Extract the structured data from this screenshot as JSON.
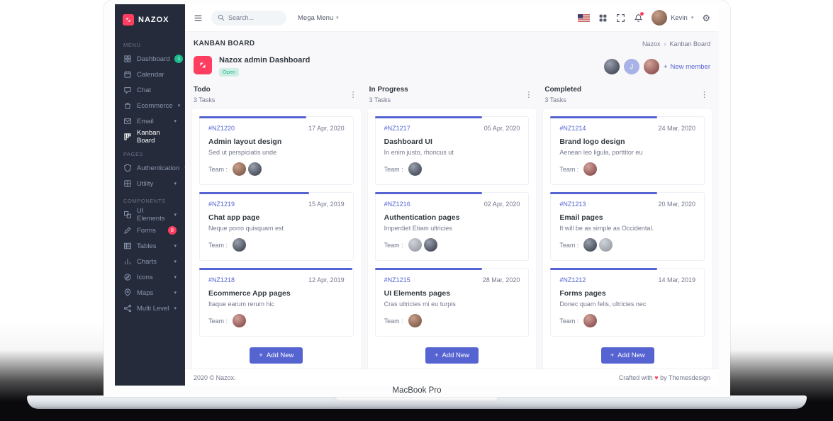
{
  "device": {
    "label": "MacBook Pro"
  },
  "colors": {
    "accent": "#5664d2",
    "sidebar_bg": "#252b3b",
    "success": "#1cbb8c",
    "danger": "#ff3d60"
  },
  "sidebar": {
    "logo_text": "NAZOX",
    "section_menu": "MENU",
    "section_pages": "PAGES",
    "section_components": "COMPONENTS",
    "items": [
      {
        "label": "Dashboard",
        "icon": "dashboard-icon",
        "badge": "1"
      },
      {
        "label": "Calendar",
        "icon": "calendar-icon"
      },
      {
        "label": "Chat",
        "icon": "chat-icon"
      },
      {
        "label": "Ecommerce",
        "icon": "shopping-bag-icon",
        "chevron": "true"
      },
      {
        "label": "Email",
        "icon": "envelope-icon",
        "chevron": "true"
      },
      {
        "label": "Kanban Board",
        "icon": "kanban-icon",
        "active": "true"
      },
      {
        "label": "Authentication",
        "icon": "shield-icon",
        "chevron": "true"
      },
      {
        "label": "Utility",
        "icon": "utility-icon",
        "chevron": "true"
      },
      {
        "label": "UI Elements",
        "icon": "ui-elements-icon",
        "chevron": "true"
      },
      {
        "label": "Forms",
        "icon": "pencil-icon",
        "badge": "8"
      },
      {
        "label": "Tables",
        "icon": "table-icon",
        "chevron": "true"
      },
      {
        "label": "Charts",
        "icon": "bar-chart-icon",
        "chevron": "true"
      },
      {
        "label": "Icons",
        "icon": "compass-icon",
        "chevron": "true"
      },
      {
        "label": "Maps",
        "icon": "map-pin-icon",
        "chevron": "true"
      },
      {
        "label": "Multi Level",
        "icon": "share-icon",
        "chevron": "true"
      }
    ]
  },
  "topbar": {
    "search_placeholder": "Search...",
    "mega_menu": "Mega Menu",
    "user_name": "Kevin",
    "icons": [
      "menu-icon",
      "search-icon",
      "flag-us-icon",
      "apps-grid-icon",
      "fullscreen-icon",
      "bell-icon",
      "gear-icon"
    ]
  },
  "page": {
    "title": "KANBAN BOARD",
    "breadcrumb": [
      "Nazox",
      "Kanban Board"
    ],
    "board_title": "Nazox admin Dashboard",
    "board_status": "Open",
    "avatar_initial": "J",
    "new_member": "New member"
  },
  "labels": {
    "team": "Team :"
  },
  "columns": [
    {
      "name": "Todo",
      "count": "3 Tasks",
      "add_label": "Add New",
      "tasks": [
        {
          "ref": "#NZ1220",
          "date": "17 Apr, 2020",
          "title": "Admin layout design",
          "desc": "Sed ut perspiciatis unde",
          "members": 2,
          "progress": 70
        },
        {
          "ref": "#NZ1219",
          "date": "15 Apr, 2019",
          "title": "Chat app page",
          "desc": "Neque porro quisquam est",
          "members": 1,
          "progress": 72
        },
        {
          "ref": "#NZ1218",
          "date": "12 Apr, 2019",
          "title": "Ecommerce App pages",
          "desc": "Itaque earum rerum hic",
          "members": 1,
          "progress": 100
        }
      ]
    },
    {
      "name": "In Progress",
      "count": "3 Tasks",
      "add_label": "Add New",
      "tasks": [
        {
          "ref": "#NZ1217",
          "date": "05 Apr, 2020",
          "title": "Dashboard UI",
          "desc": "In enim justo, rhoncus ut",
          "members": 1,
          "progress": 70
        },
        {
          "ref": "#NZ1216",
          "date": "02 Apr, 2020",
          "title": "Authentication pages",
          "desc": "Imperdiet Etiam ultricies",
          "members": 2,
          "progress": 70
        },
        {
          "ref": "#NZ1215",
          "date": "28 Mar, 2020",
          "title": "UI Elements pages",
          "desc": "Cras ultricies mi eu turpis",
          "members": 1,
          "progress": 70
        }
      ]
    },
    {
      "name": "Completed",
      "count": "3 Tasks",
      "add_label": "Add New",
      "tasks": [
        {
          "ref": "#NZ1214",
          "date": "24 Mar, 2020",
          "title": "Brand logo design",
          "desc": "Aenean leo ligula, porttitor eu",
          "members": 1,
          "progress": 70
        },
        {
          "ref": "#NZ1213",
          "date": "20 Mar, 2020",
          "title": "Email pages",
          "desc": "It will be as simple as Occidental.",
          "members": 2,
          "progress": 70
        },
        {
          "ref": "#NZ1212",
          "date": "14 Mar, 2019",
          "title": "Forms pages",
          "desc": "Donec quam felis, ultricies nec",
          "members": 1,
          "progress": 70
        }
      ]
    }
  ],
  "footer": {
    "left": "2020 © Nazox.",
    "right_prefix": "Crafted with",
    "right_suffix": "by Themesdesign"
  }
}
